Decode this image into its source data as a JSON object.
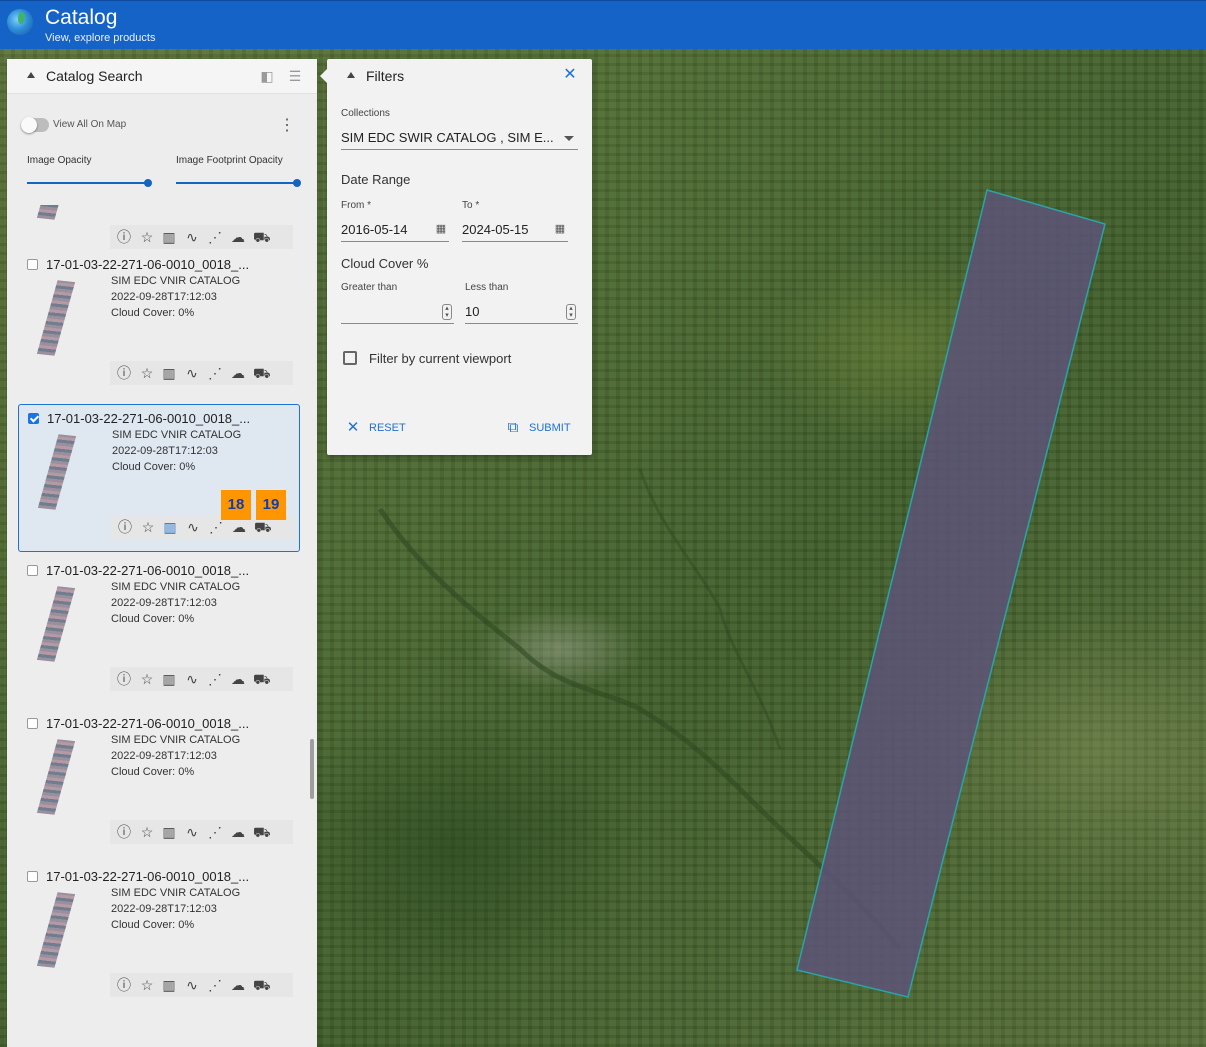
{
  "app": {
    "title": "Catalog",
    "subtitle": "View, explore products"
  },
  "catalog_panel": {
    "title": "Catalog Search",
    "view_all_label": "View All On Map",
    "image_opacity_label": "Image Opacity",
    "footprint_opacity_label": "Image Footprint Opacity",
    "image_opacity": 1.0,
    "footprint_opacity": 1.0
  },
  "results": [
    {
      "name": "",
      "collection": "",
      "date": "",
      "cloud": "",
      "checked": false,
      "partial": true
    },
    {
      "name": "17-01-03-22-271-06-0010_0018_...",
      "collection": "SIM EDC VNIR CATALOG",
      "date": "2022-09-28T17:12:03",
      "cloud": "Cloud Cover: 0%",
      "checked": false
    },
    {
      "name": "17-01-03-22-271-06-0010_0018_...",
      "collection": "SIM EDC VNIR CATALOG",
      "date": "2022-09-28T17:12:03",
      "cloud": "Cloud Cover: 0%",
      "checked": true
    },
    {
      "name": "17-01-03-22-271-06-0010_0018_...",
      "collection": "SIM EDC VNIR CATALOG",
      "date": "2022-09-28T17:12:03",
      "cloud": "Cloud Cover: 0%",
      "checked": false
    },
    {
      "name": "17-01-03-22-271-06-0010_0018_...",
      "collection": "SIM EDC VNIR CATALOG",
      "date": "2022-09-28T17:12:03",
      "cloud": "Cloud Cover: 0%",
      "checked": false
    },
    {
      "name": "17-01-03-22-271-06-0010_0018_...",
      "collection": "SIM EDC VNIR CATALOG",
      "date": "2022-09-28T17:12:03",
      "cloud": "Cloud Cover: 0%",
      "checked": false
    }
  ],
  "badges": [
    "18",
    "19"
  ],
  "action_icons": [
    "info-icon",
    "star-icon",
    "map-icon",
    "trend-icon",
    "spectral-icon",
    "cloud-download-icon",
    "cart-icon"
  ],
  "filters": {
    "title": "Filters",
    "collections_label": "Collections",
    "collections_value": "SIM EDC SWIR CATALOG , SIM E...",
    "date_range_label": "Date Range",
    "from_label": "From *",
    "from_value": "2016-05-14",
    "to_label": "To *",
    "to_value": "2024-05-15",
    "cloud_label": "Cloud Cover %",
    "greater_label": "Greater than",
    "greater_value": "",
    "less_label": "Less than",
    "less_value": "10",
    "viewport_label": "Filter by current viewport",
    "reset_label": "RESET",
    "submit_label": "SUBMIT"
  },
  "colors": {
    "appbar": "#1663c7",
    "accent": "#1e72d0",
    "badge": "#ff9500",
    "footprint": "#5c5478"
  }
}
